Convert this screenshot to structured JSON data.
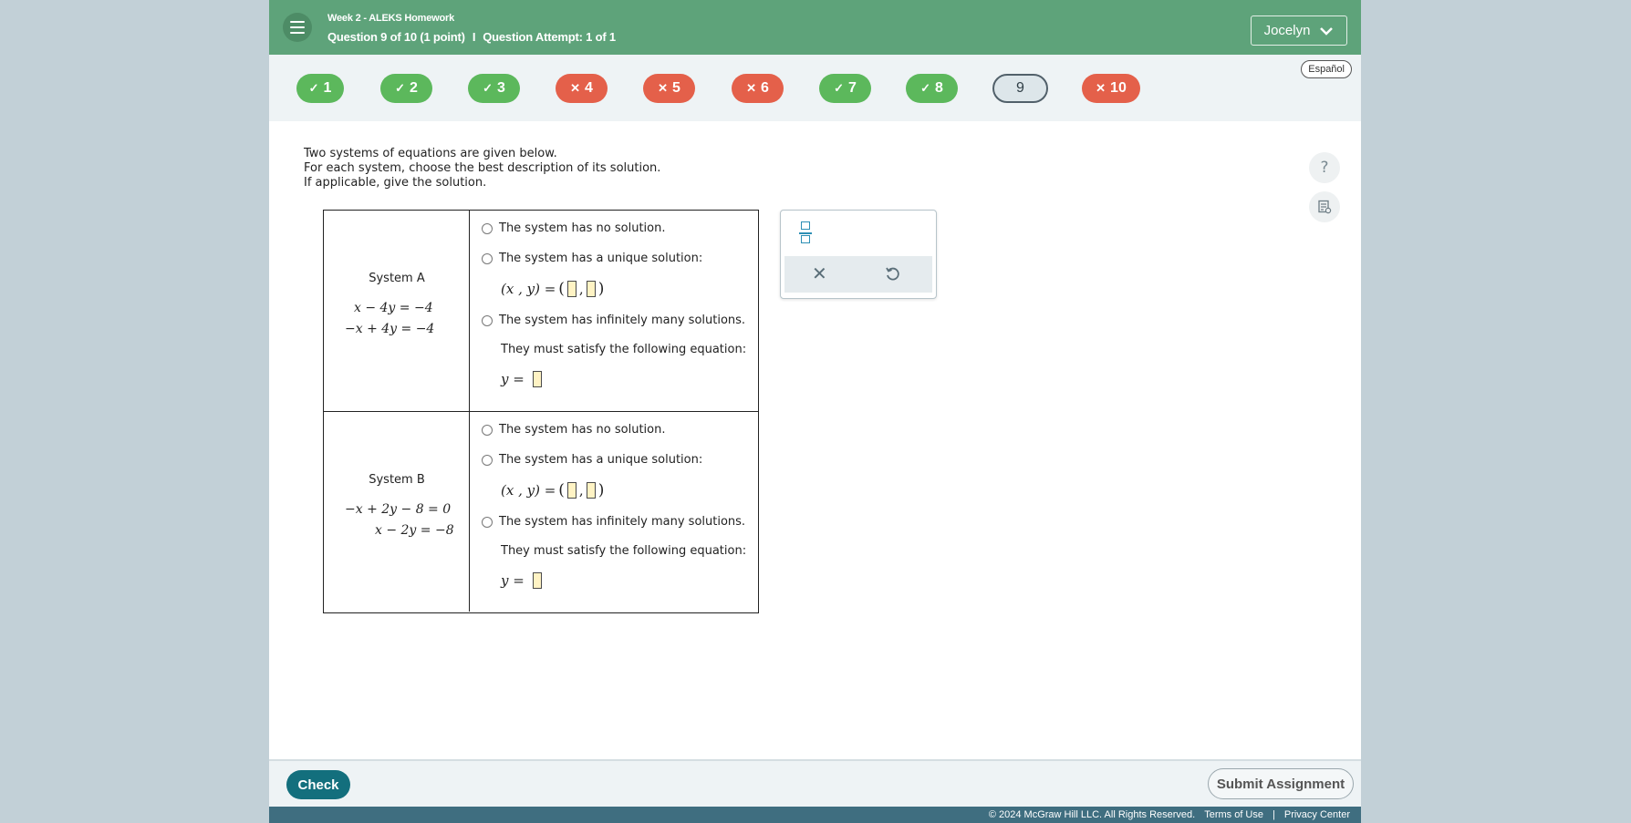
{
  "header": {
    "title": "Week 2 - ALEKS Homework",
    "question_info": "Question 9 of 10 (1 point)",
    "separator": "I",
    "attempt_info": "Question Attempt: 1 of 1",
    "user_name": "Jocelyn",
    "bg_color": "#5ea37a"
  },
  "question_nav": {
    "items": [
      {
        "label": "1",
        "status": "correct",
        "mark": "✓"
      },
      {
        "label": "2",
        "status": "correct",
        "mark": "✓"
      },
      {
        "label": "3",
        "status": "correct",
        "mark": "✓"
      },
      {
        "label": "4",
        "status": "incorrect",
        "mark": "✕"
      },
      {
        "label": "5",
        "status": "incorrect",
        "mark": "✕"
      },
      {
        "label": "6",
        "status": "incorrect",
        "mark": "✕"
      },
      {
        "label": "7",
        "status": "correct",
        "mark": "✓"
      },
      {
        "label": "8",
        "status": "correct",
        "mark": "✓"
      },
      {
        "label": "9",
        "status": "current",
        "mark": ""
      },
      {
        "label": "10",
        "status": "incorrect",
        "mark": "✕"
      }
    ],
    "language_label": "Español"
  },
  "question": {
    "line1": "Two systems of equations are given below.",
    "line2": "For each system, choose the best description of its solution.",
    "line3": "If applicable, give the solution.",
    "systems": [
      {
        "name": "System A",
        "eq1": "x − 4y = −4",
        "eq2": "−x + 4y = −4",
        "options": {
          "no_solution": "The system has no solution.",
          "unique": "The system has a unique solution:",
          "unique_math": "(x , y) =",
          "infinite": "The system has infinitely many solutions.",
          "satisfy": "They must satisfy the following equation:",
          "y_eq": "y ="
        }
      },
      {
        "name": "System B",
        "eq1": "−x + 2y − 8 = 0",
        "eq2": "x − 2y = −8",
        "options": {
          "no_solution": "The system has no solution.",
          "unique": "The system has a unique solution:",
          "unique_math": "(x , y) =",
          "infinite": "The system has infinitely many solutions.",
          "satisfy": "They must satisfy the following equation:",
          "y_eq": "y ="
        }
      }
    ]
  },
  "palette": {
    "fraction_icon": "fraction-icon",
    "clear_icon": "close-icon",
    "clear_glyph": "✕",
    "undo_icon": "undo-icon"
  },
  "side_tools": {
    "help_glyph": "?",
    "help_icon": "question-mark-icon",
    "notes_icon": "notes-icon"
  },
  "footer": {
    "check_label": "Check",
    "submit_label": "Submit Assignment",
    "copyright": "© 2024 McGraw Hill LLC. All Rights Reserved.",
    "terms": "Terms of Use",
    "divider": "|",
    "privacy": "Privacy Center"
  },
  "colors": {
    "correct": "#5cb85c",
    "incorrect": "#e4604a",
    "check_button": "#136f7d",
    "footer_strip": "#3f6e80"
  }
}
